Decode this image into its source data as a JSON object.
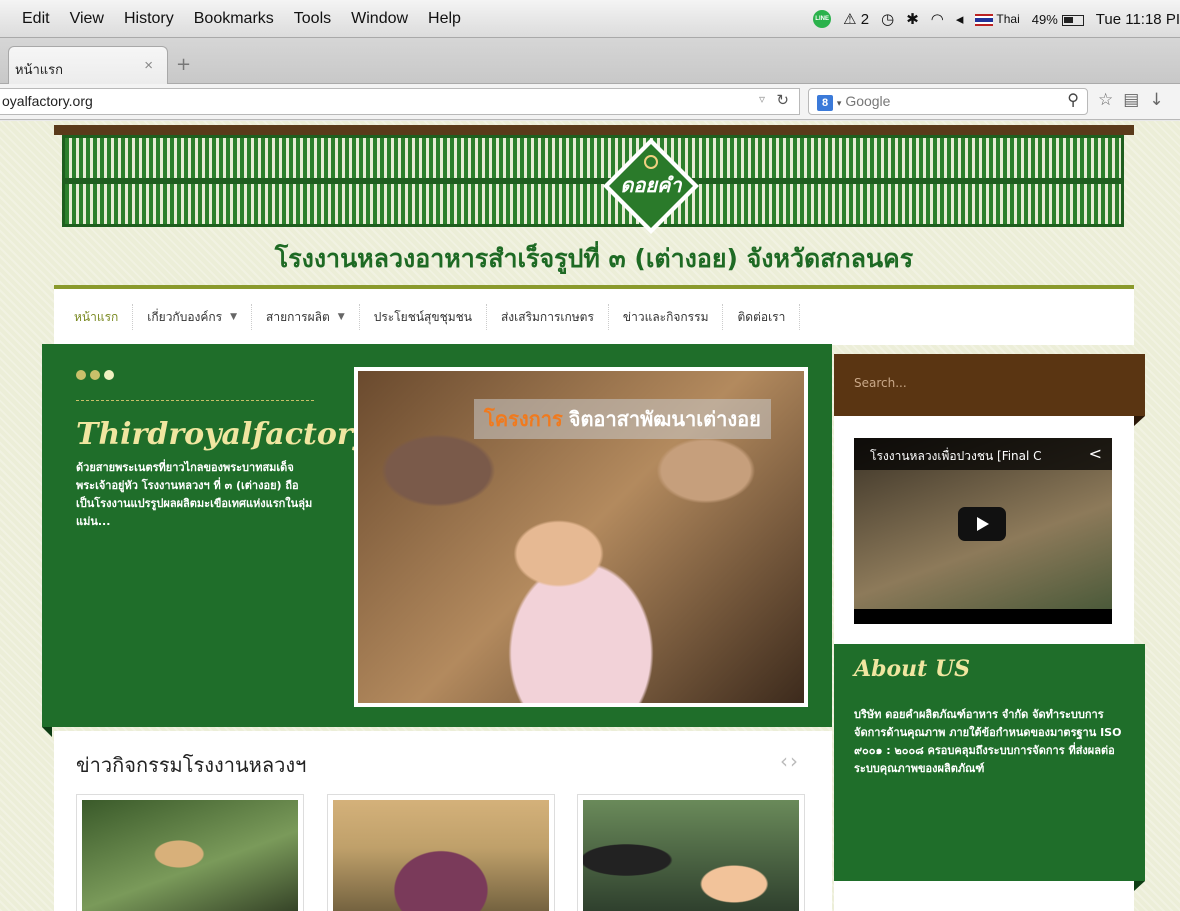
{
  "menubar": {
    "items": [
      "Edit",
      "View",
      "History",
      "Bookmarks",
      "Tools",
      "Window",
      "Help"
    ],
    "status_notif": "2",
    "input_source": "Thai",
    "battery": "49%",
    "clock": "Tue 11:18 PI"
  },
  "browser": {
    "tab_title": "หน้าแรก",
    "url": "oyalfactory.org",
    "search_placeholder": "Google"
  },
  "site": {
    "title": "โรงงานหลวงอาหารสำเร็จรูปที่ ๓ (เต่างอย) จังหวัดสกลนคร",
    "nav": [
      {
        "label": "หน้าแรก",
        "dropdown": false
      },
      {
        "label": "เกี่ยวกับองค์กร",
        "dropdown": true
      },
      {
        "label": "สายการผลิต",
        "dropdown": true
      },
      {
        "label": "ประโยชน์สุขชุมชน",
        "dropdown": false
      },
      {
        "label": "ส่งเสริมการเกษตร",
        "dropdown": false
      },
      {
        "label": "ข่าวและกิจกรรม",
        "dropdown": false
      },
      {
        "label": "ติดต่อเรา",
        "dropdown": false
      }
    ],
    "slider": {
      "title": "Thirdroyalfactory",
      "text": "ด้วยสายพระเนตรที่ยาวไกลของพระบาทสมเด็จพระเจ้าอยู่หัว โรงงานหลวงฯ ที่ ๓ (เต่างอย) ถือเป็นโรงงานแปรรูปผลผลิตมะเขือเทศแห่งแรกในลุ่มแม่น...",
      "caption_highlight": "โครงการ",
      "caption_rest": "จิตอาสาพัฒนาเต่างอย"
    },
    "sidebar": {
      "search_placeholder": "Search...",
      "video_title": "โรงงานหลวงเพื่อปวงชน [Final C",
      "about_title": "About US",
      "about_text": "บริษัท ดอยคำผลิตภัณฑ์อาหาร จำกัด จัดทำระบบการจัดการด้านคุณภาพ ภายใต้ข้อกำหนดของมาตรฐาน ISO ๙๐๐๑ : ๒๐๐๘ ครอบคลุมถึงระบบการจัดการ ที่ส่งผลต่อระบบคุณภาพของผลิตภัณฑ์"
    },
    "news": {
      "title": "ข่าวกิจกรรมโรงงานหลวงฯ",
      "arrows": "‹›"
    },
    "logo_text": "ดอยคำ"
  },
  "colors": {
    "green": "#1f6e2a",
    "brown": "#5a3512",
    "accent_yellow": "#f0e6a0",
    "title_green": "#1e6a24"
  }
}
